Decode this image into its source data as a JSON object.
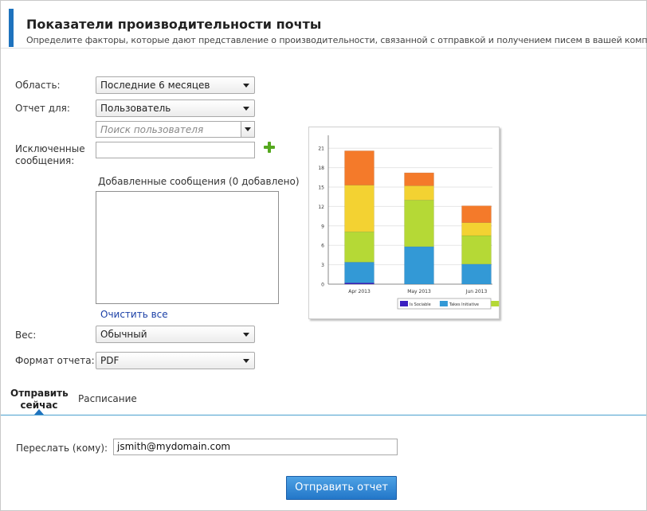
{
  "header": {
    "title": "Показатели производительности почты",
    "subtitle": "Определите факторы, которые дают представление о производительности, связанной с отправкой и получением писем в вашей компании."
  },
  "form": {
    "scope": {
      "label": "Область:",
      "value": "Последние 6 месяцев"
    },
    "report_for": {
      "label": "Отчет для:",
      "value": "Пользователь"
    },
    "user_search": {
      "placeholder": "Поиск пользователя"
    },
    "excluded": {
      "label_line1": "Исключенные",
      "label_line2": "сообщения:",
      "value": ""
    },
    "added_messages_label": "Добавленные сообщения (0 добавлено)",
    "clear_all": "Очистить все",
    "weight": {
      "label": "Вес:",
      "value": "Обычный"
    },
    "format": {
      "label": "Формат отчета:",
      "value": "PDF"
    }
  },
  "tabs": {
    "send_now_line1": "Отправить",
    "send_now_line2": "сейчас",
    "schedule": "Расписание",
    "active": "send_now"
  },
  "send": {
    "forward_label": "Переслать (кому):",
    "forward_value": "jsmith@mydomain.com",
    "submit_label": "Отправить отчет"
  },
  "chart_data": {
    "type": "bar",
    "stacked": true,
    "categories": [
      "Apr 2013",
      "May 2013",
      "Jun 2013"
    ],
    "yticks": [
      "0",
      "3",
      "6",
      "9",
      "12",
      "15",
      "18",
      "21"
    ],
    "ylim": [
      0,
      22.5
    ],
    "series": [
      {
        "name": "Is Sociable",
        "color": "#3a1fc0",
        "values": [
          0.2,
          0,
          0
        ]
      },
      {
        "name": "Takes Initiative",
        "color": "#3399d6",
        "values": [
          3.2,
          5.8,
          3.1
        ]
      },
      {
        "name": "",
        "color": "#b5d936",
        "values": [
          4.7,
          7.2,
          4.4
        ]
      },
      {
        "name": "",
        "color": "#f3d232",
        "values": [
          7.2,
          2.2,
          2.0
        ]
      },
      {
        "name": "",
        "color": "#f47a2a",
        "values": [
          5.3,
          2.0,
          2.6
        ]
      }
    ],
    "legend_position": "bottom-right",
    "grid": true
  }
}
